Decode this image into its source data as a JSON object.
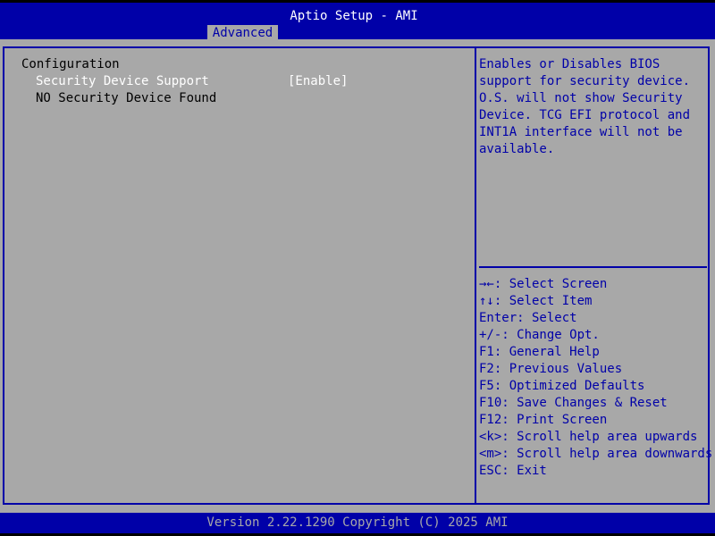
{
  "header": {
    "title": "Aptio Setup - AMI",
    "active_tab": "Advanced"
  },
  "main": {
    "section_title": "Configuration",
    "setting_label": "Security Device Support",
    "setting_value": "[Enable]",
    "status_text": "NO Security Device Found"
  },
  "help": {
    "description": "Enables or Disables BIOS\nsupport for security device.\nO.S. will not show Security\nDevice. TCG EFI protocol and\nINT1A interface will not be\navailable.",
    "keys": [
      "→←: Select Screen",
      "↑↓: Select Item",
      "Enter: Select",
      "+/-: Change Opt.",
      "F1: General Help",
      "F2: Previous Values",
      "F5: Optimized Defaults",
      "F10: Save Changes & Reset",
      "F12: Print Screen",
      "<k>: Scroll help area upwards",
      "<m>: Scroll help area downwards",
      "ESC: Exit"
    ]
  },
  "footer": {
    "text": "Version 2.22.1290 Copyright (C) 2025 AMI"
  },
  "colors": {
    "bios_blue": "#0000a8",
    "bios_gray": "#a8a8a8",
    "text_white": "#ffffff",
    "text_black": "#000000"
  }
}
